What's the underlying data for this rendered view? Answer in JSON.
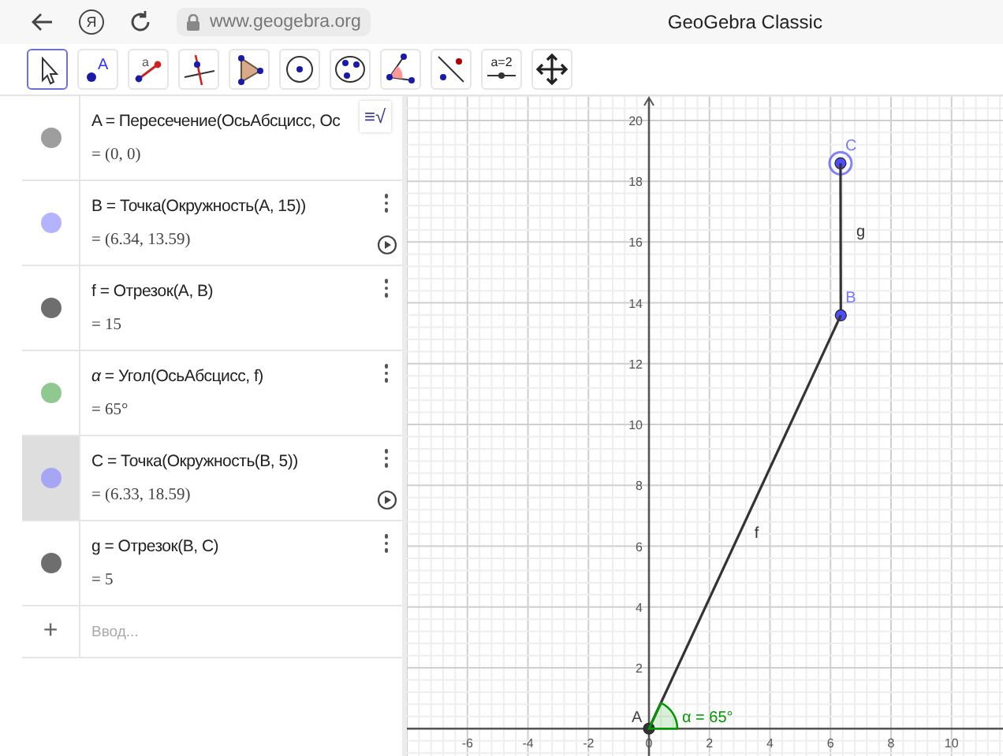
{
  "browser": {
    "logo": "Я",
    "url": "www.geogebra.org",
    "title": "GeoGebra Classic"
  },
  "tools": [
    {
      "kind": "move",
      "selected": true
    },
    {
      "kind": "point",
      "label": "A",
      "selected": false
    },
    {
      "kind": "segment",
      "label": "a",
      "selected": false
    },
    {
      "kind": "perpendicular",
      "selected": false
    },
    {
      "kind": "polygon",
      "selected": false
    },
    {
      "kind": "circle",
      "selected": false
    },
    {
      "kind": "conic",
      "selected": false
    },
    {
      "kind": "angle",
      "selected": false
    },
    {
      "kind": "reflect",
      "selected": false
    },
    {
      "kind": "slider",
      "label": "a=2",
      "selected": false
    },
    {
      "kind": "pan",
      "selected": false
    }
  ],
  "algebra": {
    "toggle_icon": "≡√",
    "rows": [
      {
        "color": "#9e9e9e",
        "definition": "A = Пересечение(ОсьАбсцисс, Ос",
        "value": "= (0, 0)",
        "menu": false,
        "play": false,
        "selected": false
      },
      {
        "color": "#b3b3ff",
        "definition": "B = Точка(Окружность(A, 15))",
        "value": "= (6.34, 13.59)",
        "menu": true,
        "play": true,
        "selected": false
      },
      {
        "color": "#6e6e6e",
        "definition": "f = Отрезок(A, B)",
        "value": "= 15",
        "menu": true,
        "play": false,
        "selected": false
      },
      {
        "color": "#8fc98f",
        "definition": "*α* = Угол(ОсьАбсцисс, f)",
        "value": "= 65°",
        "menu": true,
        "play": false,
        "selected": false
      },
      {
        "color": "#a6a6f5",
        "definition": "C = Точка(Окружность(B, 5))",
        "value": "= (6.33, 18.59)",
        "menu": true,
        "play": true,
        "selected": true
      },
      {
        "color": "#6e6e6e",
        "definition": "g = Отрезок(B, C)",
        "value": "= 5",
        "menu": true,
        "play": false,
        "selected": false
      }
    ],
    "input": {
      "icon": "+",
      "placeholder": "Ввод..."
    }
  },
  "graphics": {
    "chart_data": {
      "type": "line",
      "x": [
        0,
        6.34,
        6.33
      ],
      "series": [
        {
          "name": "f",
          "color": "#333333",
          "marker": "circle",
          "values": [
            0,
            13.59,
            null
          ]
        },
        {
          "name": "g",
          "color": "#333333",
          "marker": "circle",
          "values": [
            null,
            13.59,
            18.59
          ]
        }
      ],
      "grid": true,
      "xlim": [
        -8,
        11.7
      ],
      "ylim": [
        -0.9,
        20.8
      ],
      "xticks": [
        -6,
        -4,
        -2,
        0,
        2,
        4,
        6,
        8,
        10
      ],
      "yticks": [
        2,
        4,
        6,
        8,
        10,
        12,
        14,
        16,
        18,
        20
      ],
      "annotations": [
        {
          "x": 6.33,
          "y": 18.59,
          "text": "C"
        },
        {
          "x": 6.34,
          "y": 13.59,
          "text": "B"
        },
        {
          "x": 0,
          "y": 0,
          "text": "A"
        },
        {
          "x": 0,
          "y": 0,
          "text": "α = 65°"
        }
      ]
    },
    "points": [
      {
        "color": "#4d4dff",
        "selected": true
      },
      {
        "color": "#4d4dff",
        "selected": false
      },
      {
        "color": "#333333",
        "selected": false
      }
    ],
    "angle": {
      "color": "#009900"
    }
  }
}
